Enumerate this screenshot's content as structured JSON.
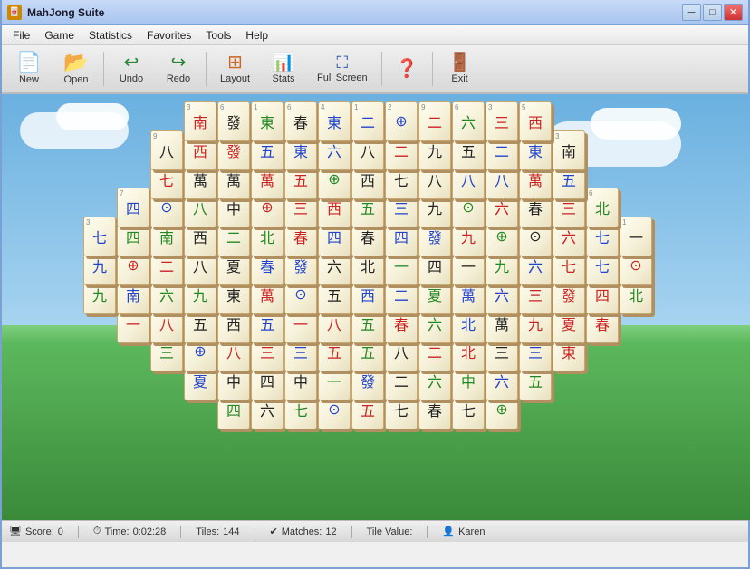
{
  "window": {
    "title": "MahJong Suite",
    "controls": {
      "minimize": "─",
      "maximize": "□",
      "close": "✕"
    }
  },
  "menu": {
    "items": [
      "File",
      "Game",
      "Statistics",
      "Favorites",
      "Tools",
      "Help"
    ]
  },
  "toolbar": {
    "buttons": [
      {
        "id": "new",
        "label": "New",
        "icon": "📄"
      },
      {
        "id": "open",
        "label": "Open",
        "icon": "📂"
      },
      {
        "id": "undo",
        "label": "Undo",
        "icon": "↩"
      },
      {
        "id": "redo",
        "label": "Redo",
        "icon": "↪"
      },
      {
        "id": "layout",
        "label": "Layout",
        "icon": "⊞"
      },
      {
        "id": "stats",
        "label": "Stats",
        "icon": "📊"
      },
      {
        "id": "fullscreen",
        "label": "Full Screen",
        "icon": "⛶"
      },
      {
        "id": "help",
        "label": "",
        "icon": "❓"
      },
      {
        "id": "exit",
        "label": "Exit",
        "icon": "🚪"
      }
    ]
  },
  "status": {
    "score_label": "Score:",
    "score_value": "0",
    "time_label": "Time:",
    "time_value": "0:02:28",
    "tiles_label": "Tiles:",
    "tiles_value": "144",
    "matches_label": "Matches:",
    "matches_value": "12",
    "tile_value_label": "Tile Value:",
    "tile_value": "",
    "user": "Karen"
  },
  "colors": {
    "tile_bg": "#fffef0",
    "tile_border": "#c8a870",
    "tile_shadow": "#b09060",
    "red": "#cc2222",
    "green": "#228822",
    "blue": "#2244cc"
  }
}
